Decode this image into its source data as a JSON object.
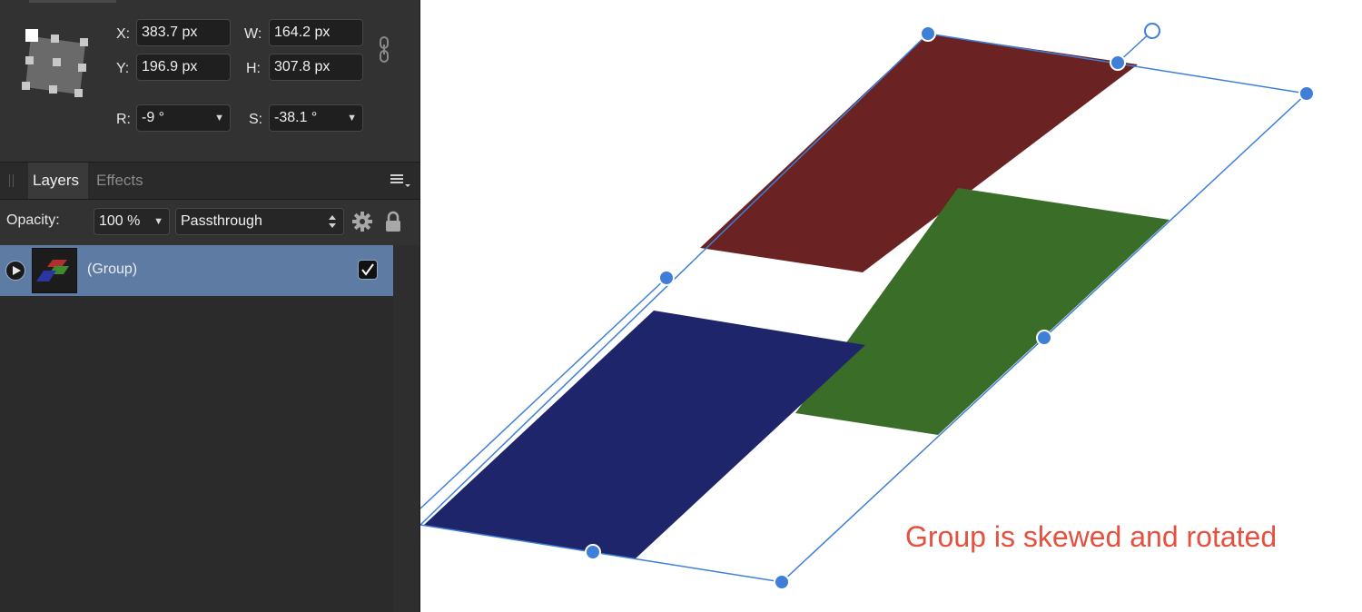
{
  "transform": {
    "x_label": "X:",
    "x_value": "383.7 px",
    "y_label": "Y:",
    "y_value": "196.9 px",
    "w_label": "W:",
    "w_value": "164.2 px",
    "h_label": "H:",
    "h_value": "307.8 px",
    "r_label": "R:",
    "r_value": "-9 °",
    "s_label": "S:",
    "s_value": "-38.1 °"
  },
  "tabs": {
    "layers": "Layers",
    "effects": "Effects"
  },
  "layer_options": {
    "opacity_label": "Opacity:",
    "opacity_value": "100 %",
    "blend_mode": "Passthrough"
  },
  "layers": [
    {
      "name": "(Group)",
      "visible": true,
      "selected": true
    }
  ],
  "canvas": {
    "annotation": "Group is skewed and rotated"
  },
  "colors": {
    "red_shape": "#6a2222",
    "green_shape": "#3a6e28",
    "blue_shape": "#1f256b",
    "selection": "#3f7fd8",
    "annotation": "#e5503f",
    "selected_row": "#5e7ba3"
  },
  "icons": {
    "anchor": "anchor-widget-icon",
    "link": "chain-link-icon",
    "panel_menu": "hamburger-menu-icon",
    "gear": "gear-icon",
    "lock": "lock-icon",
    "expand": "disclosure-triangle-icon",
    "check": "checkmark-icon"
  }
}
